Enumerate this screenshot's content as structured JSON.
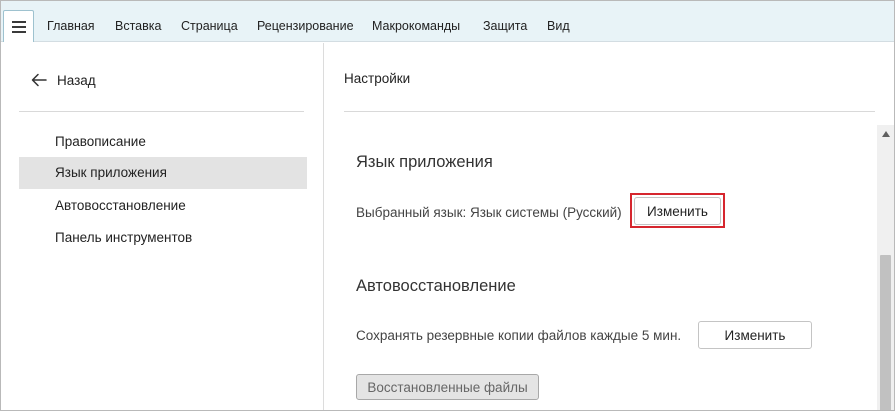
{
  "menubar": {
    "tabs": [
      {
        "label": "Главная"
      },
      {
        "label": "Вставка"
      },
      {
        "label": "Страница"
      },
      {
        "label": "Рецензирование"
      },
      {
        "label": "Макрокоманды"
      },
      {
        "label": "Защита"
      },
      {
        "label": "Вид"
      }
    ]
  },
  "sidebar": {
    "back_label": "Назад",
    "items": [
      {
        "label": "Правописание"
      },
      {
        "label": "Язык приложения",
        "active": true
      },
      {
        "label": "Автовосстановление"
      },
      {
        "label": "Панель инструментов"
      }
    ]
  },
  "main": {
    "title": "Настройки",
    "language": {
      "heading": "Язык приложения",
      "selected_text": "Выбранный язык: Язык системы (Русский)",
      "change_label": "Изменить"
    },
    "autorecovery": {
      "heading": "Автовосстановление",
      "interval_text": "Сохранять резервные копии файлов каждые 5 мин.",
      "change_label": "Изменить",
      "recovered_files_label": "Восстановленные файлы"
    }
  },
  "colors": {
    "menubar_bg": "#e8f3f7",
    "active_item_bg": "#e3e3e3",
    "highlight": "#d6262e"
  }
}
